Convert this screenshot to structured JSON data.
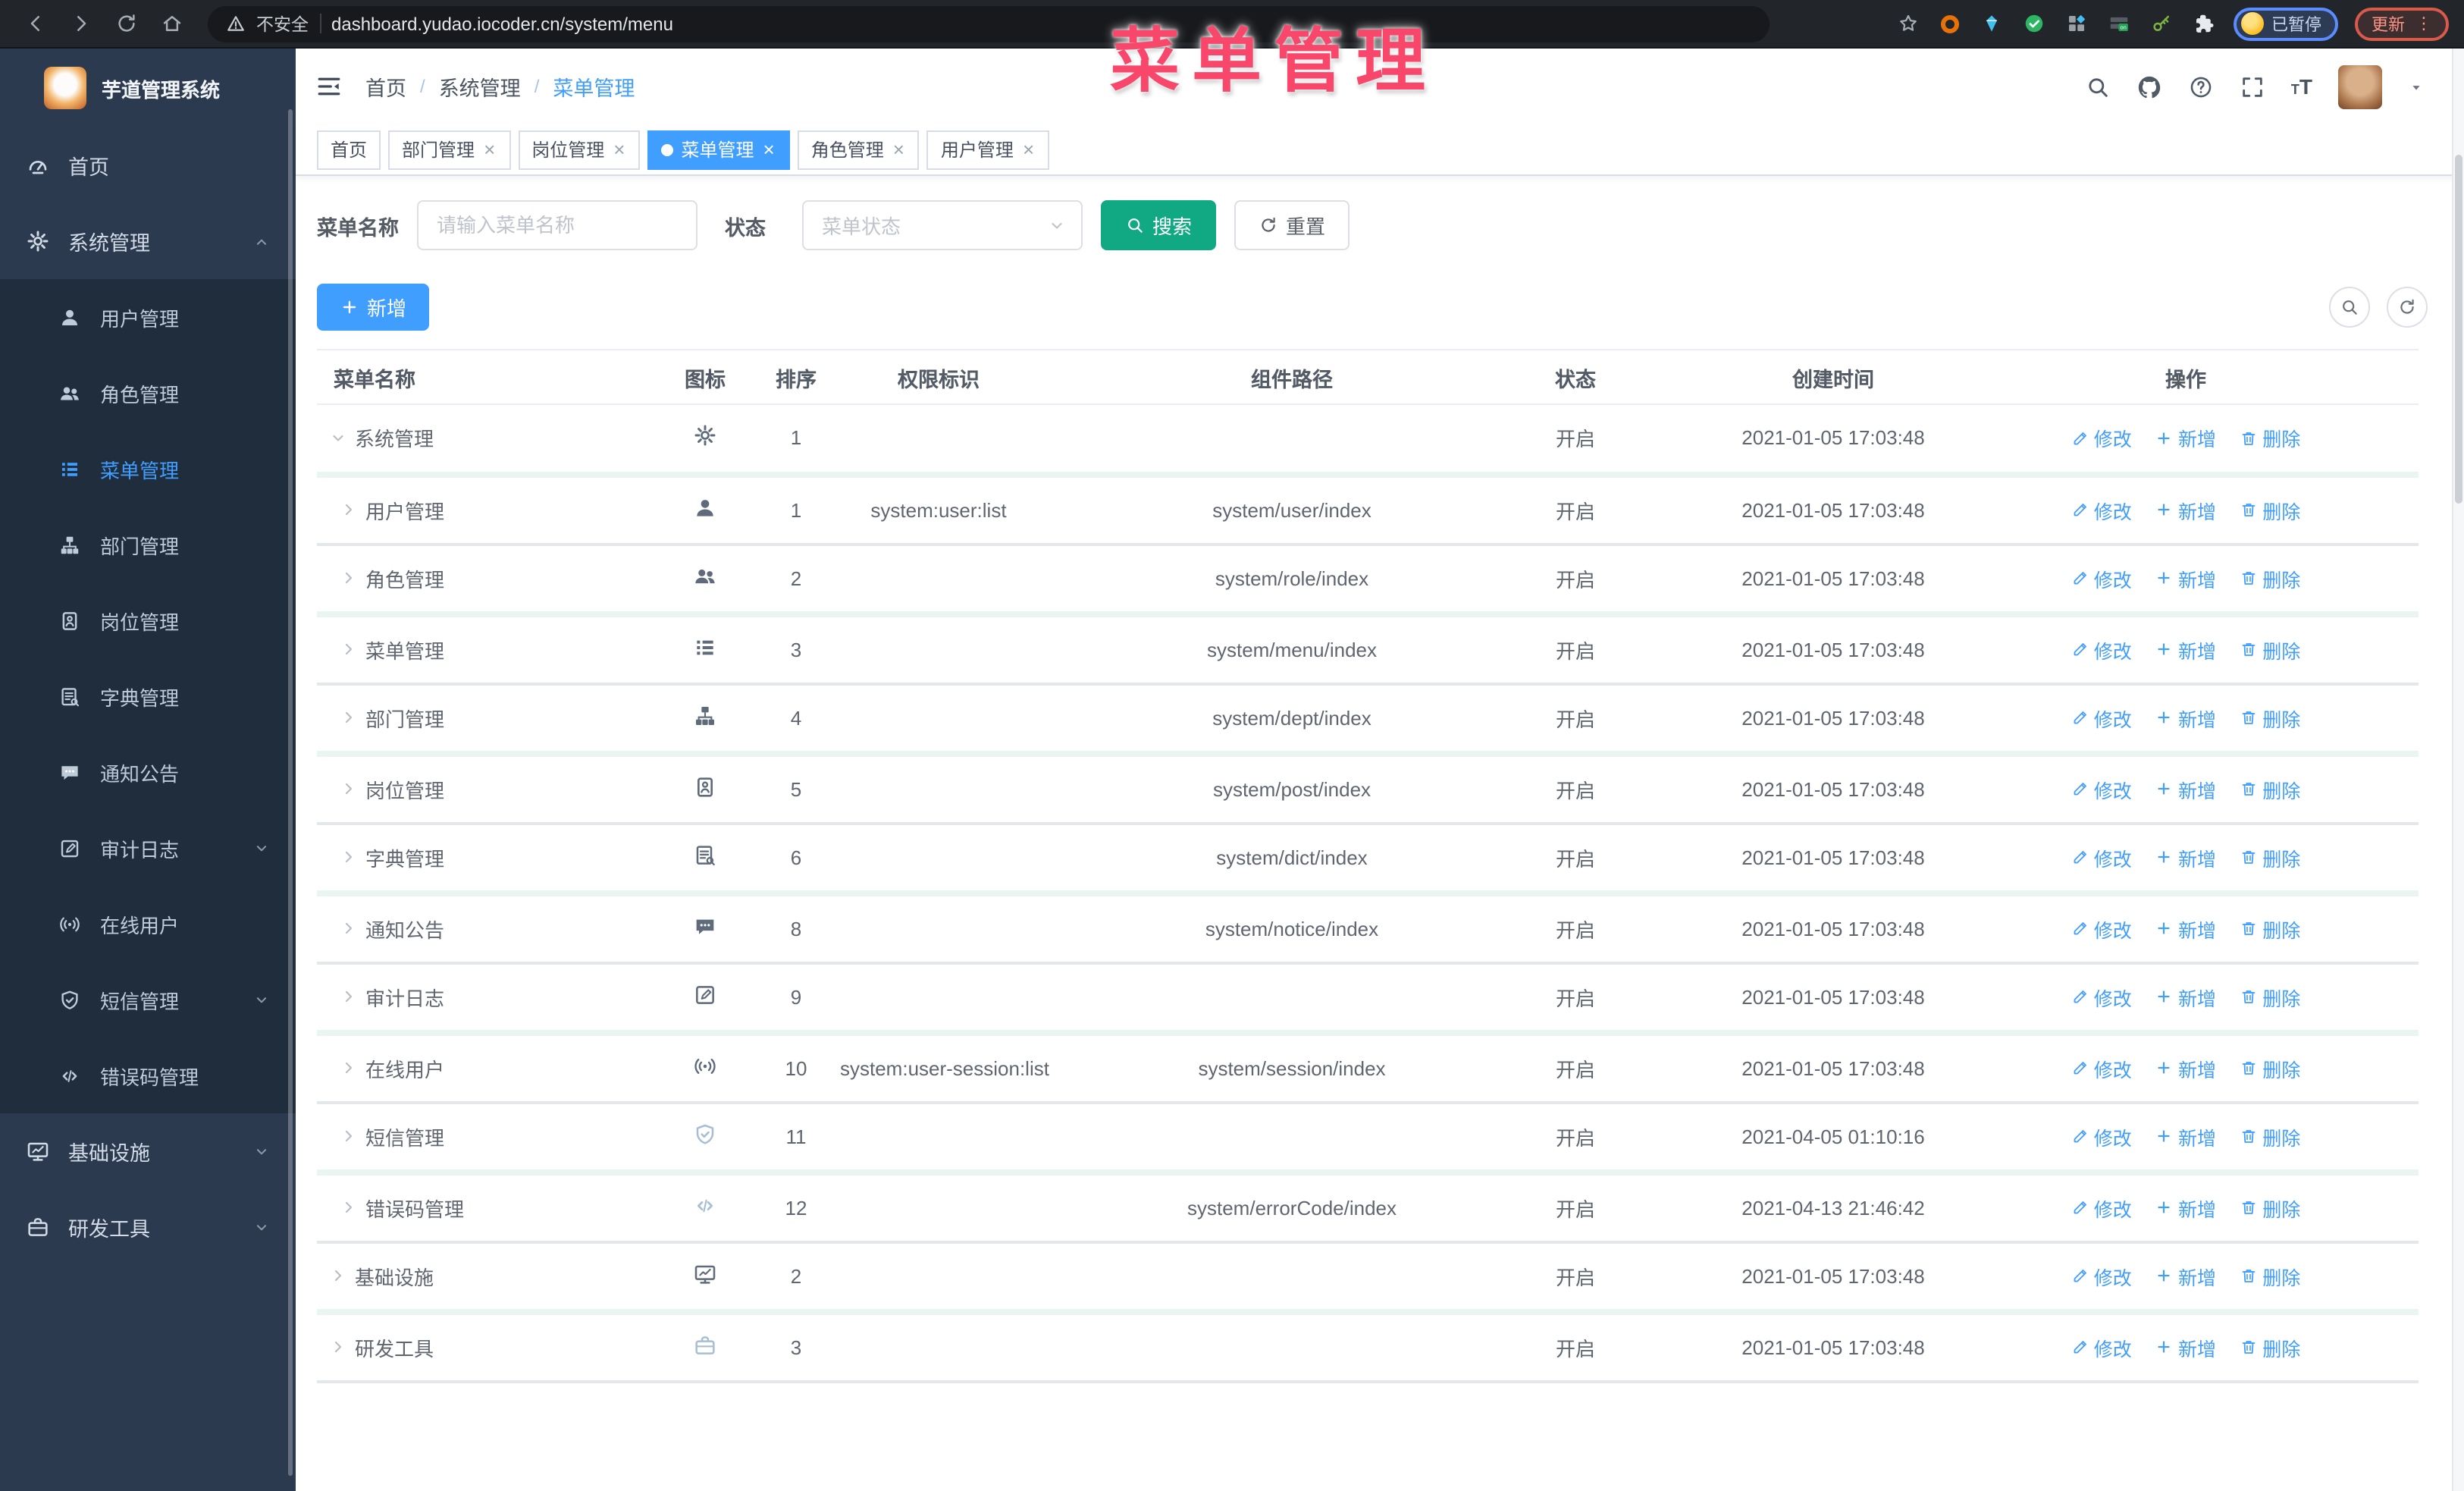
{
  "browser": {
    "security_label": "不安全",
    "url": "dashboard.yudao.iocoder.cn/system/menu",
    "profile_status": "已暂停",
    "update_label": "更新",
    "update_dots": "⋮"
  },
  "overlay_title": "菜单管理",
  "sidebar": {
    "app_title": "芋道管理系统",
    "items": [
      {
        "label": "首页",
        "icon": "dashboard",
        "level": 0
      },
      {
        "label": "系统管理",
        "icon": "gear",
        "level": 0,
        "chevron": "up"
      },
      {
        "label": "用户管理",
        "icon": "user",
        "level": 1
      },
      {
        "label": "角色管理",
        "icon": "users",
        "level": 1
      },
      {
        "label": "菜单管理",
        "icon": "list",
        "level": 1,
        "active": true
      },
      {
        "label": "部门管理",
        "icon": "tree",
        "level": 1
      },
      {
        "label": "岗位管理",
        "icon": "badge",
        "level": 1
      },
      {
        "label": "字典管理",
        "icon": "book",
        "level": 1
      },
      {
        "label": "通知公告",
        "icon": "message",
        "level": 1
      },
      {
        "label": "审计日志",
        "icon": "note",
        "level": 1,
        "chevron": "down"
      },
      {
        "label": "在线用户",
        "icon": "signal",
        "level": 1
      },
      {
        "label": "短信管理",
        "icon": "shield",
        "level": 1,
        "chevron": "down"
      },
      {
        "label": "错误码管理",
        "icon": "code",
        "level": 1
      },
      {
        "label": "基础设施",
        "icon": "monitor",
        "level": 0,
        "chevron": "down"
      },
      {
        "label": "研发工具",
        "icon": "tool",
        "level": 0,
        "chevron": "down"
      }
    ]
  },
  "header": {
    "breadcrumb": [
      "首页",
      "系统管理",
      "菜单管理"
    ]
  },
  "tabs": [
    {
      "label": "首页"
    },
    {
      "label": "部门管理",
      "closable": true
    },
    {
      "label": "岗位管理",
      "closable": true
    },
    {
      "label": "菜单管理",
      "closable": true,
      "active": true
    },
    {
      "label": "角色管理",
      "closable": true
    },
    {
      "label": "用户管理",
      "closable": true
    }
  ],
  "filters": {
    "name_label": "菜单名称",
    "name_placeholder": "请输入菜单名称",
    "name_value": "",
    "status_label": "状态",
    "status_placeholder": "菜单状态",
    "search_label": "搜索",
    "reset_label": "重置",
    "add_label": "新增"
  },
  "table": {
    "columns": [
      "菜单名称",
      "图标",
      "排序",
      "权限标识",
      "组件路径",
      "状态",
      "创建时间",
      "操作"
    ],
    "actions": {
      "edit": "修改",
      "add": "新增",
      "delete": "删除"
    },
    "rows": [
      {
        "name": "系统管理",
        "icon": "gear",
        "level": 0,
        "expanded": true,
        "sort": 1,
        "perm": "",
        "path": "",
        "status": "开启",
        "time": "2021-01-05 17:03:48"
      },
      {
        "name": "用户管理",
        "icon": "user",
        "level": 1,
        "sort": 1,
        "perm": "system:user:list",
        "path": "system/user/index",
        "status": "开启",
        "time": "2021-01-05 17:03:48"
      },
      {
        "name": "角色管理",
        "icon": "users",
        "level": 1,
        "sort": 2,
        "perm": "",
        "path": "system/role/index",
        "status": "开启",
        "time": "2021-01-05 17:03:48"
      },
      {
        "name": "菜单管理",
        "icon": "list",
        "level": 1,
        "sort": 3,
        "perm": "",
        "path": "system/menu/index",
        "status": "开启",
        "time": "2021-01-05 17:03:48"
      },
      {
        "name": "部门管理",
        "icon": "tree",
        "level": 1,
        "sort": 4,
        "perm": "",
        "path": "system/dept/index",
        "status": "开启",
        "time": "2021-01-05 17:03:48"
      },
      {
        "name": "岗位管理",
        "icon": "badge",
        "level": 1,
        "sort": 5,
        "perm": "",
        "path": "system/post/index",
        "status": "开启",
        "time": "2021-01-05 17:03:48"
      },
      {
        "name": "字典管理",
        "icon": "book",
        "level": 1,
        "sort": 6,
        "perm": "",
        "path": "system/dict/index",
        "status": "开启",
        "time": "2021-01-05 17:03:48"
      },
      {
        "name": "通知公告",
        "icon": "message",
        "level": 1,
        "sort": 8,
        "perm": "",
        "path": "system/notice/index",
        "status": "开启",
        "time": "2021-01-05 17:03:48"
      },
      {
        "name": "审计日志",
        "icon": "note",
        "level": 1,
        "sort": 9,
        "perm": "",
        "path": "",
        "status": "开启",
        "time": "2021-01-05 17:03:48"
      },
      {
        "name": "在线用户",
        "icon": "signal",
        "level": 1,
        "sort": 10,
        "perm": "system:user-session:list",
        "path": "system/session/index",
        "status": "开启",
        "time": "2021-01-05 17:03:48"
      },
      {
        "name": "短信管理",
        "icon": "shield",
        "level": 1,
        "sort": 11,
        "perm": "",
        "path": "",
        "status": "开启",
        "time": "2021-04-05 01:10:16",
        "tone": "lt"
      },
      {
        "name": "错误码管理",
        "icon": "code",
        "level": 1,
        "sort": 12,
        "perm": "",
        "path": "system/errorCode/index",
        "status": "开启",
        "time": "2021-04-13 21:46:42",
        "tone": "lt"
      },
      {
        "name": "基础设施",
        "icon": "monitor",
        "level": 0,
        "sort": 2,
        "perm": "",
        "path": "",
        "status": "开启",
        "time": "2021-01-05 17:03:48"
      },
      {
        "name": "研发工具",
        "icon": "tool",
        "level": 0,
        "sort": 3,
        "perm": "",
        "path": "",
        "status": "开启",
        "time": "2021-01-05 17:03:48",
        "tone": "lt"
      }
    ]
  },
  "colors": {
    "accent": "#409eff",
    "search_button": "#11a983",
    "overlay": "#f8476b",
    "sidebar_bg": "#2b3a4f",
    "submenu_bg": "#1f2d3d"
  }
}
